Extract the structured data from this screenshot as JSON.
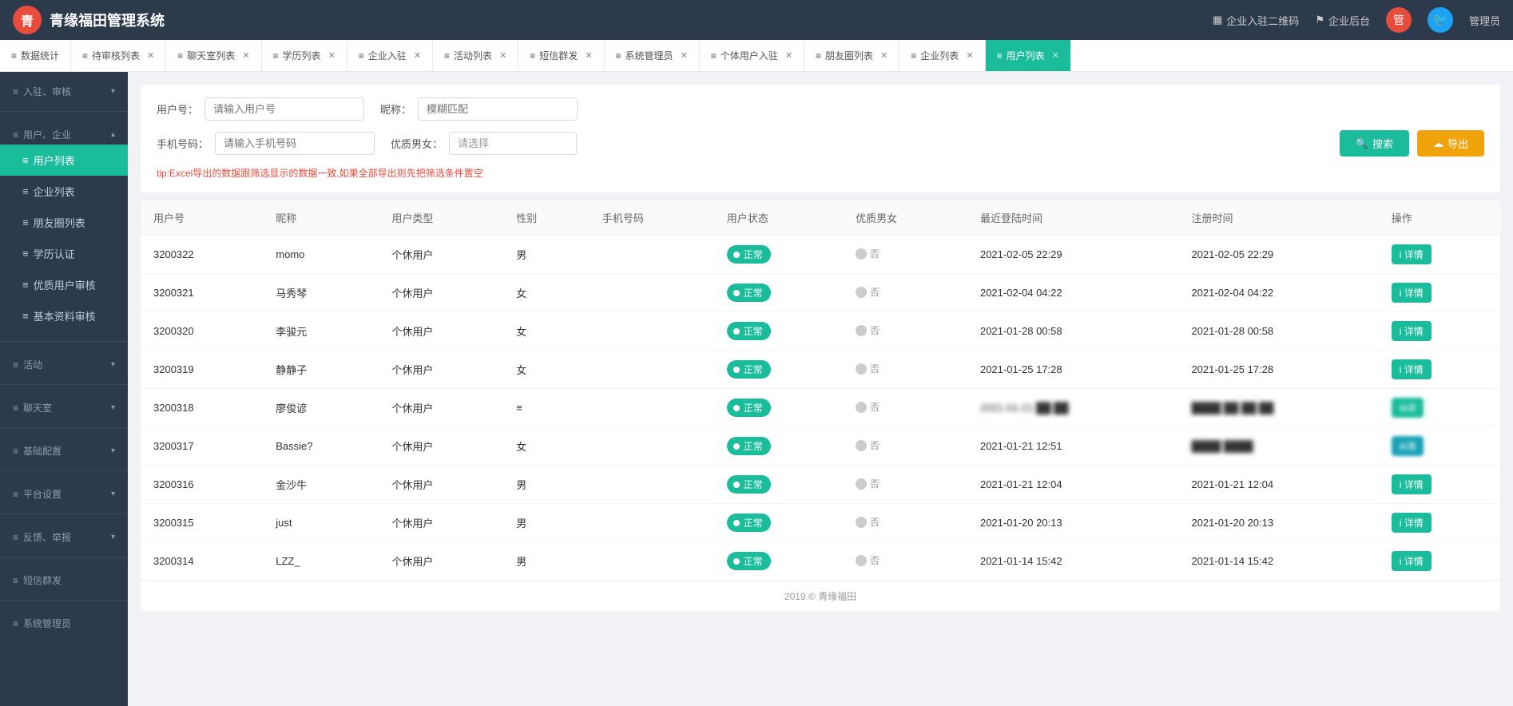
{
  "app": {
    "title": "青缘福田管理系统",
    "footer": "2019 © 青缘福田"
  },
  "header": {
    "logo_text": "青",
    "title": "青缘福田管理系统",
    "enterprise_qr": "企业入驻二维码",
    "enterprise_backend": "企业后台",
    "admin_label": "管理员"
  },
  "tabs": [
    {
      "label": "数据统计",
      "closable": false,
      "active": false
    },
    {
      "label": "待审核列表",
      "closable": true,
      "active": false
    },
    {
      "label": "聊天室列表",
      "closable": true,
      "active": false
    },
    {
      "label": "学历列表",
      "closable": true,
      "active": false
    },
    {
      "label": "企业入驻",
      "closable": true,
      "active": false
    },
    {
      "label": "活动列表",
      "closable": true,
      "active": false
    },
    {
      "label": "短信群发",
      "closable": true,
      "active": false
    },
    {
      "label": "系统管理员",
      "closable": true,
      "active": false
    },
    {
      "label": "个体用户入驻",
      "closable": true,
      "active": false
    },
    {
      "label": "朋友圈列表",
      "closable": true,
      "active": false
    },
    {
      "label": "企业列表",
      "closable": true,
      "active": false
    },
    {
      "label": "用户列表",
      "closable": true,
      "active": true
    }
  ],
  "sidebar": {
    "sections": [
      {
        "label": "入驻、审核",
        "items": []
      },
      {
        "label": "用户、企业",
        "items": [
          {
            "label": "用户列表",
            "active": true
          },
          {
            "label": "企业列表",
            "active": false
          },
          {
            "label": "朋友圈列表",
            "active": false
          },
          {
            "label": "学历认证",
            "active": false
          },
          {
            "label": "优质用户审核",
            "active": false
          },
          {
            "label": "基本资料审核",
            "active": false
          }
        ]
      },
      {
        "label": "活动",
        "items": []
      },
      {
        "label": "聊天室",
        "items": []
      },
      {
        "label": "基础配置",
        "items": []
      },
      {
        "label": "平台设置",
        "items": []
      },
      {
        "label": "反馈、举报",
        "items": []
      },
      {
        "label": "短信群发",
        "items": []
      },
      {
        "label": "系统管理员",
        "items": []
      }
    ]
  },
  "search": {
    "user_id_label": "用户号：",
    "user_id_placeholder": "请输入用户号",
    "nickname_label": "昵称：",
    "nickname_value": "模糊匹配",
    "phone_label": "手机号码：",
    "phone_placeholder": "请输入手机号码",
    "quality_label": "优质男女：",
    "quality_placeholder": "请选择",
    "search_btn": "搜索",
    "export_btn": "导出",
    "tip": "tip:Excel导出的数据跟筛选显示的数据一致,如果全部导出则先把筛选条件置空"
  },
  "table": {
    "columns": [
      "用户号",
      "昵称",
      "用户类型",
      "性别",
      "手机号码",
      "用户状态",
      "优质男女",
      "最近登陆时间",
      "注册时间",
      "操作"
    ],
    "rows": [
      {
        "id": "3200322",
        "nickname": "momo",
        "type": "个休用户",
        "gender": "男",
        "phone": "",
        "status": "正常",
        "quality": "否",
        "last_login": "2021-02-05 22:29",
        "register": "2021-02-05 22:29",
        "action": "详情"
      },
      {
        "id": "3200321",
        "nickname": "马秀琴",
        "type": "个休用户",
        "gender": "女",
        "phone": "",
        "status": "正常",
        "quality": "否",
        "last_login": "2021-02-04 04:22",
        "register": "2021-02-04 04:22",
        "action": "详情"
      },
      {
        "id": "3200320",
        "nickname": "李骏元",
        "type": "个休用户",
        "gender": "女",
        "phone": "",
        "status": "正常",
        "quality": "否",
        "last_login": "2021-01-28 00:58",
        "register": "2021-01-28 00:58",
        "action": "详情"
      },
      {
        "id": "3200319",
        "nickname": "静静子",
        "type": "个休用户",
        "gender": "女",
        "phone": "",
        "status": "正常",
        "quality": "否",
        "last_login": "2021-01-25 17:28",
        "register": "2021-01-25 17:28",
        "action": "详情"
      },
      {
        "id": "3200318",
        "nickname": "廖俊谚",
        "type": "个休用户",
        "gender": "≡",
        "phone": "",
        "status": "正常",
        "quality": "否",
        "last_login": "2021-01-21 ██:██",
        "register": "██:██ ██ ██:██",
        "action": "██详",
        "blurred": true
      },
      {
        "id": "3200317",
        "nickname": "Bassie?",
        "type": "个休用户",
        "gender": "女",
        "phone": "",
        "status": "正常",
        "quality": "否",
        "last_login": "2021-01-21 12:51",
        "register": "████ ████",
        "action": "←消",
        "blurred": true
      },
      {
        "id": "3200316",
        "nickname": "金沙牛",
        "type": "个休用户",
        "gender": "男",
        "phone": "",
        "status": "正常",
        "quality": "否",
        "last_login": "2021-01-21 12:04",
        "register": "2021-01-21 12:04",
        "action": "详情"
      },
      {
        "id": "3200315",
        "nickname": "just",
        "type": "个休用户",
        "gender": "男",
        "phone": "",
        "status": "正常",
        "quality": "否",
        "last_login": "2021-01-20 20:13",
        "register": "2021-01-20 20:13",
        "action": "详情"
      },
      {
        "id": "3200314",
        "nickname": "LZZ_",
        "type": "个休用户",
        "gender": "男",
        "phone": "",
        "status": "正常",
        "quality": "否",
        "last_login": "2021-01-14 15:42",
        "register": "2021-01-14 15:42",
        "action": "详情"
      }
    ]
  }
}
